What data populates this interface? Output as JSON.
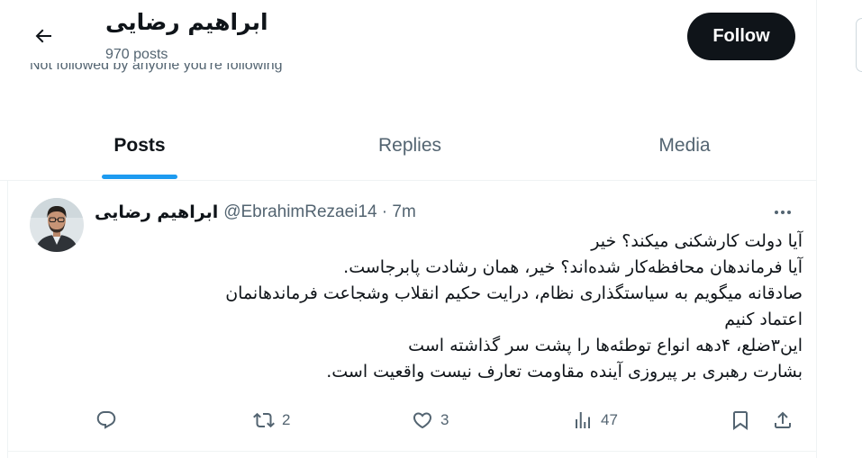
{
  "header": {
    "back_icon": "arrow-left-icon",
    "display_name": "ابراهیم رضایی",
    "post_count": "970 posts",
    "follow_note": "Not followed by anyone you're following",
    "follow_label": "Follow"
  },
  "tabs": [
    {
      "label": "Posts",
      "active": true
    },
    {
      "label": "Replies",
      "active": false
    },
    {
      "label": "Media",
      "active": false
    }
  ],
  "tweet": {
    "author_name": "ابراهیم رضایی",
    "handle_time": "@EbrahimRezaei14 · 7m",
    "more_icon": "more-dots-icon",
    "lines": [
      "آیا دولت کارشکنی میکند؟ خیر",
      "آیا فرماندهان محافظه‌کار شده‌اند؟ خیر، همان رشادت پابرجاست.",
      "صادقانه میگویم به سیاستگذاری نظام، درایت حکیم انقلاب وشجاعت فرماندهانمان",
      "اعتماد کنیم",
      "این۳ضلع، ۴دهه انواع توطئه‌ها را پشت سر گذاشته است",
      "بشارت رهبری بر پیروزی آینده مقاومت تعارف نیست واقعیت است."
    ],
    "actions": {
      "reply_count": "",
      "retweet_count": "2",
      "like_count": "3",
      "views_count": "47"
    }
  },
  "colors": {
    "accent": "#1d9bf0",
    "text_primary": "#0f1419",
    "text_secondary": "#536471",
    "follow_bg": "#0f1419"
  }
}
